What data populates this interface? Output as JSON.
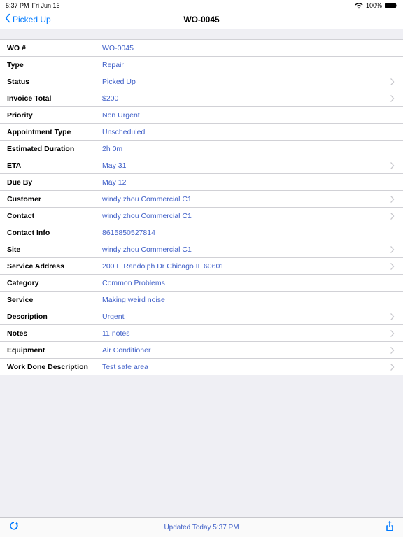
{
  "statusBar": {
    "time": "5:37 PM",
    "date": "Fri Jun 16",
    "batteryText": "100%"
  },
  "nav": {
    "back": "Picked Up",
    "title": "WO-0045"
  },
  "rows": [
    {
      "label": "WO #",
      "value": "WO-0045",
      "chevron": false
    },
    {
      "label": "Type",
      "value": "Repair",
      "chevron": false
    },
    {
      "label": "Status",
      "value": "Picked Up",
      "chevron": true
    },
    {
      "label": "Invoice Total",
      "value": "$200",
      "chevron": true
    },
    {
      "label": "Priority",
      "value": "Non Urgent",
      "chevron": false
    },
    {
      "label": "Appointment Type",
      "value": "Unscheduled",
      "chevron": false
    },
    {
      "label": "Estimated Duration",
      "value": "2h 0m",
      "chevron": false
    },
    {
      "label": "ETA",
      "value": "May 31",
      "chevron": true
    },
    {
      "label": "Due By",
      "value": "May 12",
      "chevron": false
    },
    {
      "label": "Customer",
      "value": "windy zhou Commercial C1",
      "chevron": true
    },
    {
      "label": "Contact",
      "value": "windy zhou Commercial C1",
      "chevron": true
    },
    {
      "label": "Contact Info",
      "value": "8615850527814",
      "chevron": false
    },
    {
      "label": "Site",
      "value": "windy zhou Commercial C1",
      "chevron": true
    },
    {
      "label": "Service Address",
      "value": "200 E Randolph Dr Chicago IL 60601",
      "chevron": true
    },
    {
      "label": "Category",
      "value": "Common Problems",
      "chevron": false
    },
    {
      "label": "Service",
      "value": "Making weird noise",
      "chevron": false
    },
    {
      "label": "Description",
      "value": "Urgent",
      "chevron": true
    },
    {
      "label": "Notes",
      "value": "11 notes",
      "chevron": true
    },
    {
      "label": "Equipment",
      "value": "Air Conditioner",
      "chevron": true
    },
    {
      "label": "Work Done Description",
      "value": "Test safe area",
      "chevron": true
    }
  ],
  "toolbar": {
    "updated": "Updated Today 5:37 PM"
  }
}
